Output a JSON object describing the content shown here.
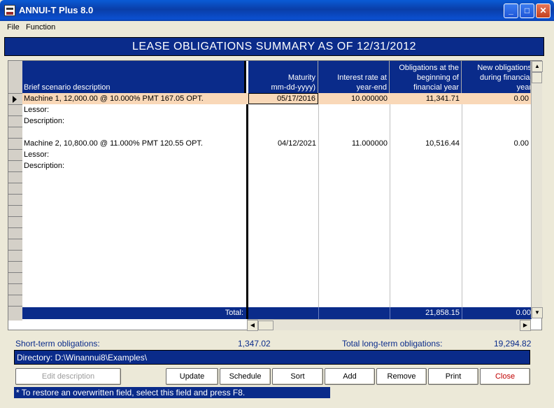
{
  "window": {
    "title": "ANNUI-T Plus 8.0",
    "buttons": {
      "minimize": "_",
      "maximize": "□",
      "close": "✕"
    }
  },
  "menu": {
    "items": [
      "File",
      "Function"
    ]
  },
  "header": {
    "title": "LEASE OBLIGATIONS SUMMARY AS OF 12/31/2012"
  },
  "grid": {
    "columns": [
      {
        "label_lines": [
          "Brief scenario description"
        ]
      },
      {
        "label_lines": [
          "Maturity",
          "mm-dd-yyyy)"
        ]
      },
      {
        "label_lines": [
          "Interest rate at",
          "year-end"
        ]
      },
      {
        "label_lines": [
          "Obligations at the",
          "beginning of",
          "financial year"
        ]
      },
      {
        "label_lines": [
          "New obligations",
          "during financial",
          "year"
        ]
      }
    ],
    "rows": [
      {
        "description": "Machine 1, 12,000.00 @ 10.000% PMT 167.05 OPT.",
        "maturity": "05/17/2016",
        "interest": "10.000000",
        "obligations_begin": "11,341.71",
        "new_obligations": "0.00",
        "selected": true
      },
      {
        "description": "Lessor:"
      },
      {
        "description": "Description:"
      },
      {
        "description": ""
      },
      {
        "description": "Machine 2, 10,800.00 @ 11.000% PMT 120.55 OPT.",
        "maturity": "04/12/2021",
        "interest": "11.000000",
        "obligations_begin": "10,516.44",
        "new_obligations": "0.00"
      },
      {
        "description": "Lessor:"
      },
      {
        "description": "Description:"
      }
    ],
    "total": {
      "label": "Total:",
      "obligations_begin": "21,858.15",
      "new_obligations": "0.00"
    }
  },
  "summary": {
    "short_term_label": "Short-term obligations:",
    "short_term_value": "1,347.02",
    "long_term_label": "Total long-term obligations:",
    "long_term_value": "19,294.82"
  },
  "directory": {
    "text": "Directory: D:\\Winannui8\\Examples\\"
  },
  "buttons": [
    {
      "name": "edit-description",
      "label": "Edit description",
      "enabled": false
    },
    {
      "name": "update",
      "label": "Update",
      "enabled": true
    },
    {
      "name": "schedule",
      "label": "Schedule",
      "enabled": true
    },
    {
      "name": "sort",
      "label": "Sort",
      "enabled": true
    },
    {
      "name": "add",
      "label": "Add",
      "enabled": true
    },
    {
      "name": "remove",
      "label": "Remove",
      "enabled": true
    },
    {
      "name": "print",
      "label": "Print",
      "enabled": true
    },
    {
      "name": "close",
      "label": "Close",
      "enabled": true
    }
  ],
  "hint": "* To restore an overwritten field, select this field and press F8."
}
